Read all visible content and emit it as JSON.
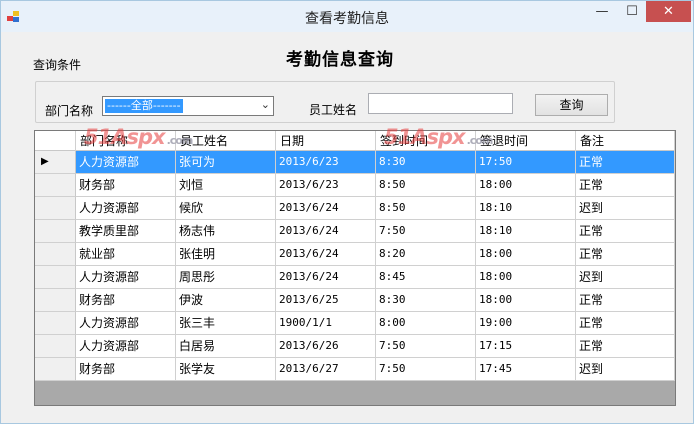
{
  "window": {
    "title": "查看考勤信息",
    "minimize_glyph": "—",
    "maximize_glyph": "☐",
    "close_glyph": "✕"
  },
  "page": {
    "conditions_label": "查询条件",
    "heading": "考勤信息查询"
  },
  "filters": {
    "dept_label": "部门名称",
    "dept_selected": "------全部-------",
    "name_label": "员工姓名",
    "name_value": "",
    "query_button": "查询"
  },
  "watermark": {
    "text": "51Aspx",
    "suffix": ".com"
  },
  "table": {
    "columns": [
      "部门名称",
      "员工姓名",
      "日期",
      "签到时间",
      "签退时间",
      "备注"
    ],
    "rows": [
      [
        "人力资源部",
        "张可为",
        "2013/6/23",
        "8:30",
        "17:50",
        "正常"
      ],
      [
        "财务部",
        "刘恒",
        "2013/6/23",
        "8:50",
        "18:00",
        "正常"
      ],
      [
        "人力资源部",
        "候欣",
        "2013/6/24",
        "8:50",
        "18:10",
        "迟到"
      ],
      [
        "教学质里部",
        "杨志伟",
        "2013/6/24",
        "7:50",
        "18:10",
        "正常"
      ],
      [
        "就业部",
        "张佳明",
        "2013/6/24",
        "8:20",
        "18:00",
        "正常"
      ],
      [
        "人力资源部",
        "周思彤",
        "2013/6/24",
        "8:45",
        "18:00",
        "迟到"
      ],
      [
        "财务部",
        "伊波",
        "2013/6/25",
        "8:30",
        "18:00",
        "正常"
      ],
      [
        "人力资源部",
        "张三丰",
        "1900/1/1",
        "8:00",
        "19:00",
        "正常"
      ],
      [
        "人力资源部",
        "白居易",
        "2013/6/26",
        "7:50",
        "17:15",
        "正常"
      ],
      [
        "财务部",
        "张学友",
        "2013/6/27",
        "7:50",
        "17:45",
        "迟到"
      ]
    ],
    "selected_row": 0,
    "row_indicator": "▶"
  },
  "colors": {
    "selection": "#3399ff",
    "close_button": "#c75050",
    "grid_background": "#a9a9a9"
  },
  "icons": [
    "app-icon",
    "minimize-icon",
    "maximize-icon",
    "close-icon",
    "chevron-down-icon",
    "row-indicator-icon"
  ]
}
